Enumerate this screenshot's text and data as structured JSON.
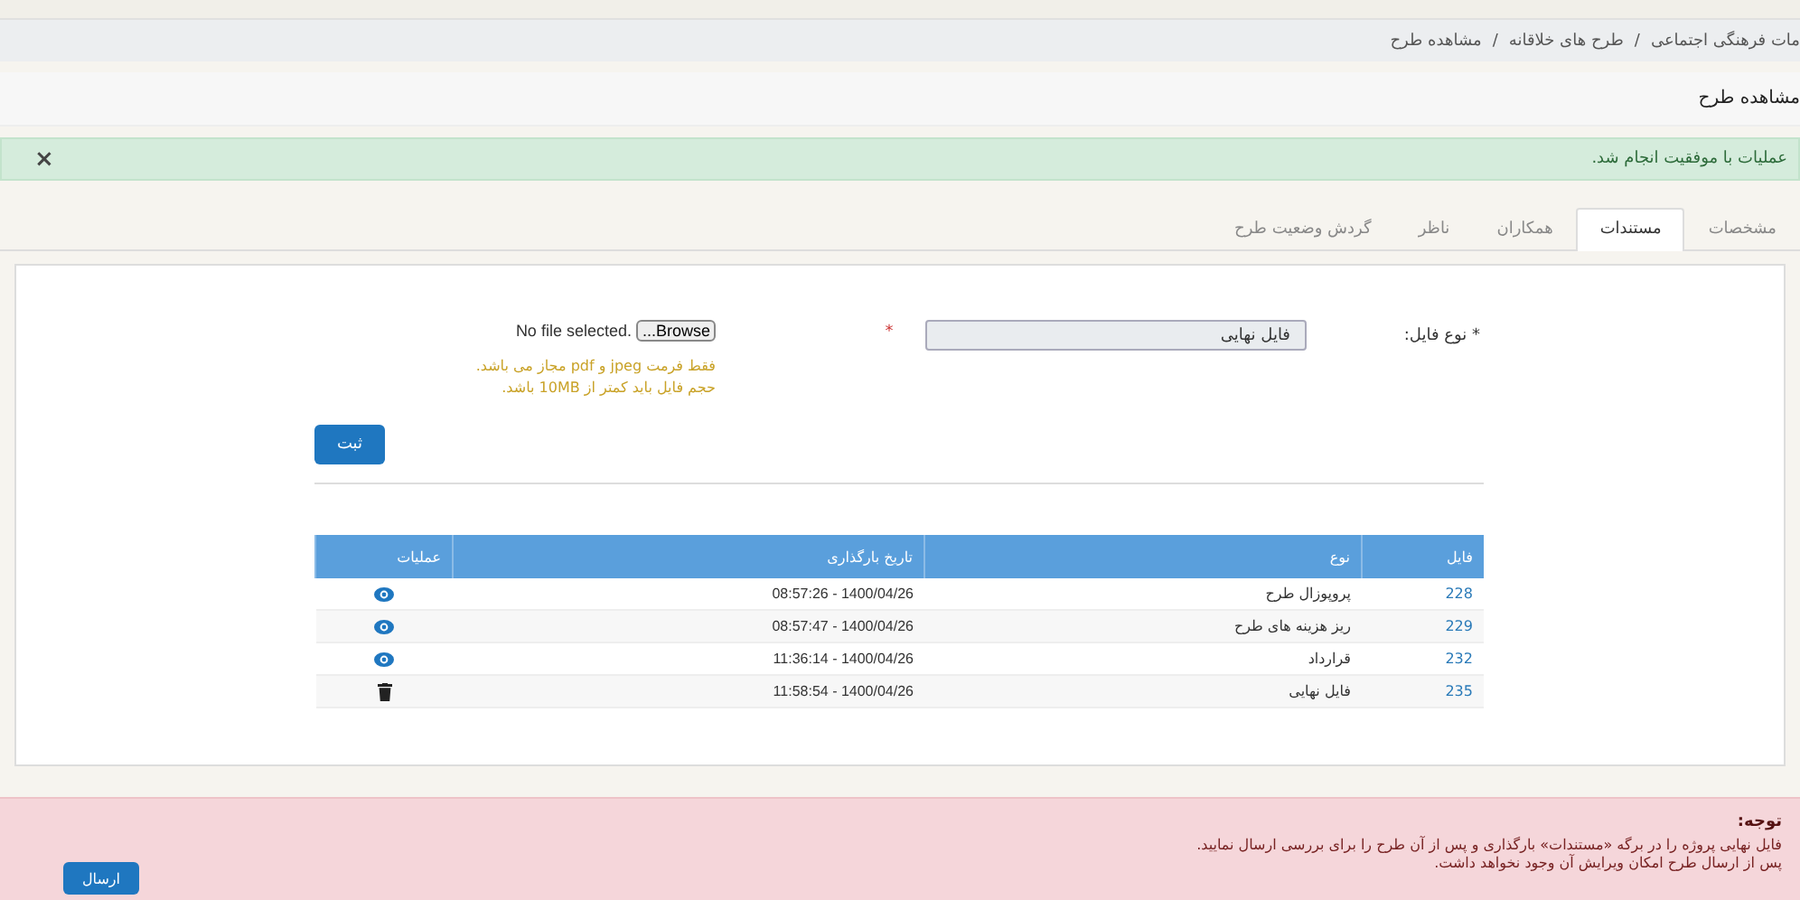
{
  "breadcrumb": {
    "items": [
      "مات فرهنگی اجتماعی",
      "طرح های خلاقانه",
      "مشاهده طرح"
    ],
    "separator": "/"
  },
  "page_title": "مشاهده طرح",
  "alert": {
    "message": "عملیات با موفقیت انجام شد.",
    "close": "×"
  },
  "tabs": [
    {
      "label": "مشخصات",
      "selected": false
    },
    {
      "label": "مستندات",
      "selected": true
    },
    {
      "label": "همکاران",
      "selected": false
    },
    {
      "label": "ناظر",
      "selected": false
    },
    {
      "label": "گردش وضعیت طرح",
      "selected": false
    }
  ],
  "form": {
    "label": "* نوع فایل:",
    "file_type": "فایل نهایی",
    "required_mark": "*",
    "browse": "...Browse",
    "file_status": "No file selected.",
    "hint": "فقط فرمت jpeg و pdf مجاز می باشد. حجم فایل باید کمتر از 10MB باشد.",
    "submit": "ثبت"
  },
  "table": {
    "columns": [
      "فایل",
      "نوع",
      "تاریخ بارگذاری",
      "عملیات"
    ],
    "rows": [
      {
        "file": "228",
        "type": "پروپوزال طرح",
        "date": "08:57:26 - 1400/04/26",
        "kind": "view"
      },
      {
        "file": "229",
        "type": "ریز هزینه های طرح",
        "date": "08:57:47 - 1400/04/26",
        "kind": "view"
      },
      {
        "file": "232",
        "type": "قرارداد",
        "date": "11:36:14 - 1400/04/26",
        "kind": "view"
      },
      {
        "file": "235",
        "type": "فایل نهایی",
        "date": "11:58:54 - 1400/04/26",
        "kind": "delete"
      }
    ]
  },
  "notice": {
    "title": "توجه:",
    "lines": [
      "فایل نهایی پروژه را در برگه «مستندات» بارگذاری و پس از آن طرح را برای بررسی ارسال نمایید.",
      "پس از ارسال طرح امکان ویرایش آن وجود نخواهد داشت."
    ],
    "send": "ارسال"
  }
}
